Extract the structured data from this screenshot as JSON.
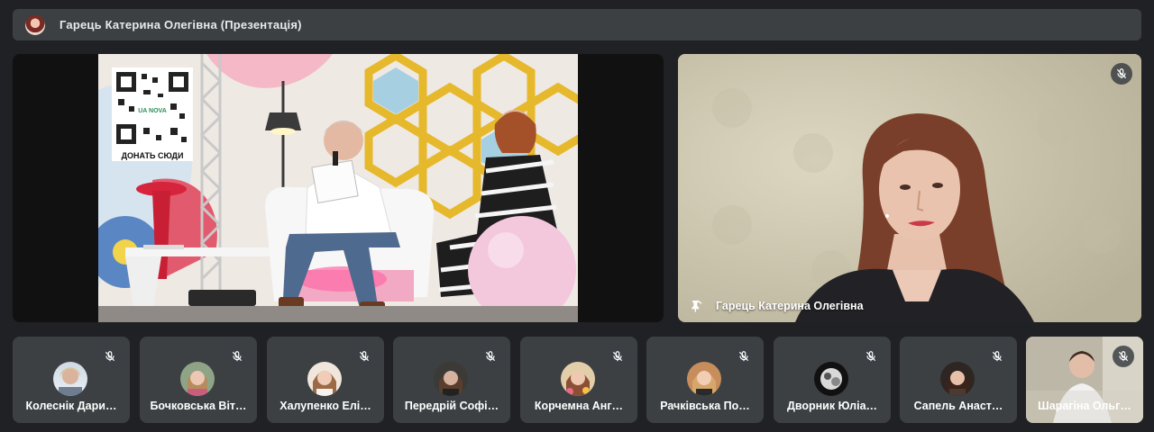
{
  "meeting": {
    "presenter_title": "Гарець Катерина Олегівна (Презентація)"
  },
  "presentation": {
    "qr_caption": "ДОНАТЬ СЮДИ",
    "qr_logo": "UA NOVA"
  },
  "main_camera": {
    "name": "Гарець Катерина Олегівна",
    "muted": true
  },
  "participants": [
    {
      "name": "Колеснік Дари…",
      "muted": true
    },
    {
      "name": "Бочковська Віт…",
      "muted": true
    },
    {
      "name": "Халупенко Елі…",
      "muted": true
    },
    {
      "name": "Передрій Софі…",
      "muted": true
    },
    {
      "name": "Корчемна Анг…",
      "muted": true
    },
    {
      "name": "Рачківська По…",
      "muted": true
    },
    {
      "name": "Дворник Юліа…",
      "muted": true
    },
    {
      "name": "Сапель Анаст…",
      "muted": true
    },
    {
      "name": "Шарагіна Ольг…",
      "muted": true
    }
  ],
  "icons": {
    "mic_off": "mic-off-icon",
    "pin": "pin-presenter-icon"
  }
}
